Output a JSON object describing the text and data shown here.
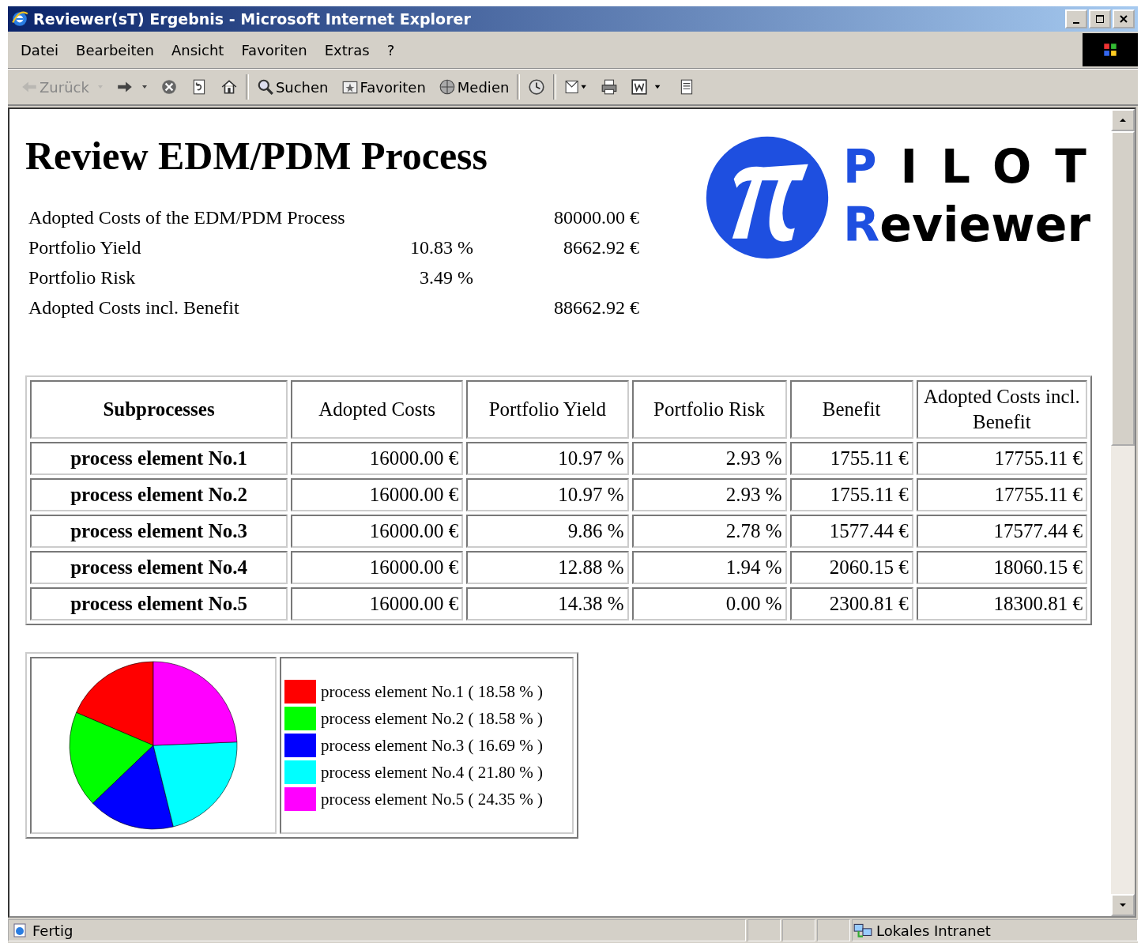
{
  "window": {
    "title": "Reviewer(sT) Ergebnis - Microsoft Internet Explorer"
  },
  "menu": [
    "Datei",
    "Bearbeiten",
    "Ansicht",
    "Favoriten",
    "Extras",
    "?"
  ],
  "toolbar": [
    {
      "kind": "back",
      "label": "Zurück",
      "disabled": true
    },
    {
      "kind": "forward",
      "disabled": false
    },
    {
      "kind": "stop",
      "disabled": false
    },
    {
      "kind": "refresh",
      "disabled": false
    },
    {
      "kind": "home",
      "disabled": false
    },
    {
      "kind": "search",
      "label": "Suchen",
      "disabled": false
    },
    {
      "kind": "favorites",
      "label": "Favoriten",
      "disabled": false
    },
    {
      "kind": "media",
      "label": "Medien",
      "disabled": false
    },
    {
      "kind": "history",
      "disabled": false
    },
    {
      "kind": "mail",
      "disabled": false
    },
    {
      "kind": "print",
      "disabled": false
    },
    {
      "kind": "edit",
      "disabled": false
    },
    {
      "kind": "discuss",
      "disabled": false
    }
  ],
  "page": {
    "heading": "Review EDM/PDM Process",
    "logo": [
      {
        "accent": "P",
        "rest": "ILOT"
      },
      {
        "accent": "R",
        "rest": "eviewer"
      }
    ],
    "summary": [
      {
        "label": "Adopted Costs of the EDM/PDM Process",
        "amount": "80000.00 €"
      },
      {
        "label": "Portfolio Yield",
        "percent": "10.83 %",
        "amount": "8662.92 €"
      },
      {
        "label": "Portfolio Risk",
        "percent": "3.49 %"
      },
      {
        "label": "Adopted Costs incl. Benefit",
        "amount": "88662.92 €"
      }
    ],
    "table": {
      "columns": [
        "Subprocesses",
        "Adopted Costs",
        "Portfolio Yield",
        "Portfolio Risk",
        "Benefit",
        "Adopted Costs incl. Benefit"
      ],
      "rows": [
        [
          "process element No.1",
          "16000.00 €",
          "10.97 %",
          "2.93 %",
          "1755.11 €",
          "17755.11 €"
        ],
        [
          "process element No.2",
          "16000.00 €",
          "10.97 %",
          "2.93 %",
          "1755.11 €",
          "17755.11 €"
        ],
        [
          "process element No.3",
          "16000.00 €",
          "9.86 %",
          "2.78 %",
          "1577.44 €",
          "17577.44 €"
        ],
        [
          "process element No.4",
          "16000.00 €",
          "12.88 %",
          "1.94 %",
          "2060.15 €",
          "18060.15 €"
        ],
        [
          "process element No.5",
          "16000.00 €",
          "14.38 %",
          "0.00 %",
          "2300.81 €",
          "18300.81 €"
        ]
      ]
    },
    "chart_data": {
      "type": "pie",
      "categories": [
        "process element No.1",
        "process element No.2",
        "process element No.3",
        "process element No.4",
        "process element No.5"
      ],
      "values": [
        18.58,
        18.58,
        16.69,
        21.8,
        24.35
      ],
      "colors": [
        "#ff0000",
        "#00ff00",
        "#0000ff",
        "#00ffff",
        "#ff00ff"
      ]
    },
    "legend": [
      {
        "percent": "( 18.58 % )"
      },
      {
        "percent": "( 18.58 % )"
      },
      {
        "percent": "( 16.69 % )"
      },
      {
        "percent": "( 21.80 % )"
      },
      {
        "percent": "( 24.35 % )"
      }
    ]
  },
  "status_bar": {
    "text": "Fertig",
    "zone": "Lokales Intranet"
  }
}
